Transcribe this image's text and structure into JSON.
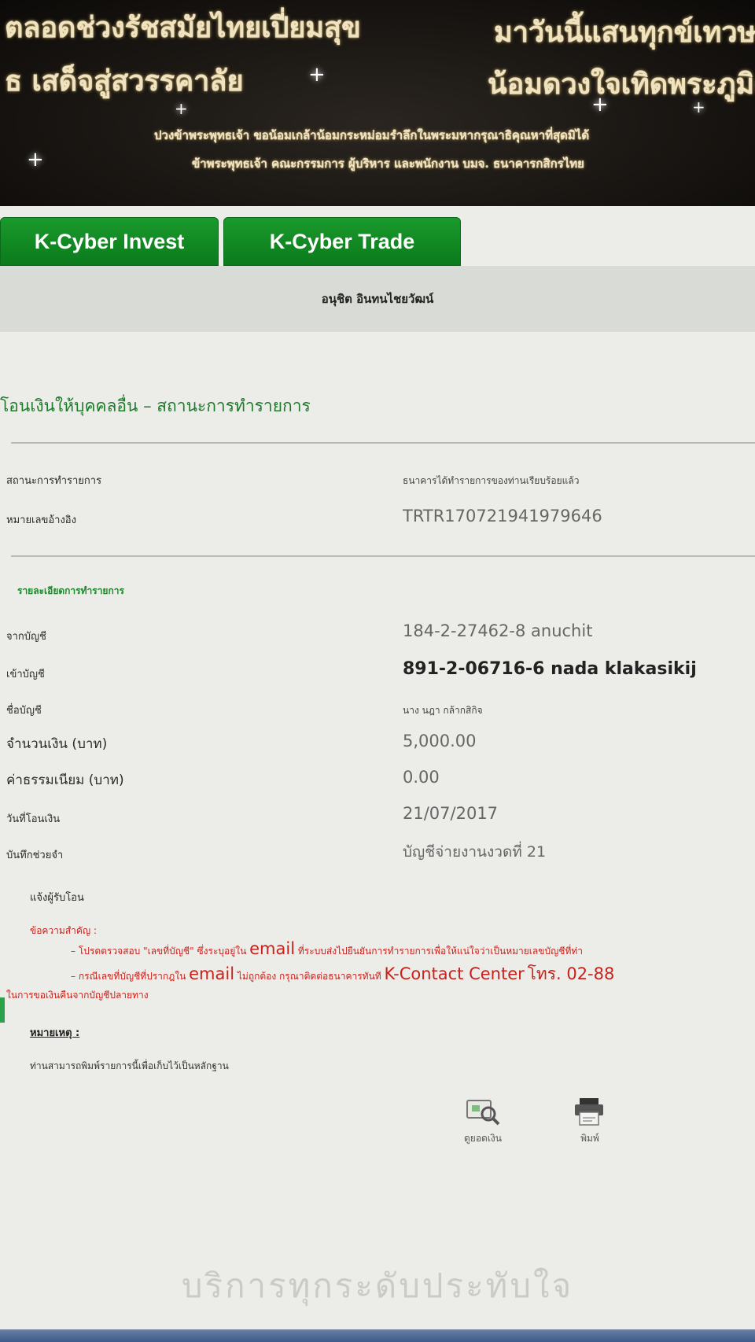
{
  "banner": {
    "line1": "ตลอดช่วงรัชสมัยไทยเปี่ยมสุข",
    "line2": "ธ เสด็จสู่สวรรคาลัย",
    "line3": "มาวันนี้แสนทุกข์เทวษ",
    "line4": "น้อมดวงใจเทิดพระภูมิต",
    "dedication1": "ปวงข้าพระพุทธเจ้า ขอน้อมเกล้าน้อมกระหม่อมรำลึกในพระมหากรุณาธิคุณหาที่สุดมิได้",
    "dedication2": "ข้าพระพุทธเจ้า คณะกรรมการ ผู้บริหาร และพนักงาน บมจ. ธนาคารกสิกรไทย"
  },
  "tabs": [
    {
      "label": "K-Cyber Invest"
    },
    {
      "label": "K-Cyber Trade"
    }
  ],
  "user": {
    "name": "อนุชิต อินทนไชยวัฒน์"
  },
  "page": {
    "heading": "โอนเงินให้บุคคลอื่น – สถานะการทำรายการ"
  },
  "status": {
    "label": "สถานะการทำรายการ",
    "value": "ธนาคารได้ทำรายการของท่านเรียบร้อยแล้ว"
  },
  "reference": {
    "label": "หมายเลขอ้างอิง",
    "value": "TRTR170721941979646"
  },
  "details_title": "รายละเอียดการทำรายการ",
  "details": [
    {
      "label": "จากบัญชี",
      "value": "184-2-27462-8 anuchit"
    },
    {
      "label": "เข้าบัญชี",
      "value": "891-2-06716-6 nada klakasikij"
    },
    {
      "label": "ชื่อบัญชี",
      "value": "นาง นฎา กล้ากสิกิจ"
    },
    {
      "label": "จำนวนเงิน (บาท)",
      "value": "5,000.00"
    },
    {
      "label": "ค่าธรรมเนียม (บาท)",
      "value": "0.00"
    },
    {
      "label": "วันที่โอนเงิน",
      "value": "21/07/2017"
    },
    {
      "label": "บันทึกช่วยจำ",
      "value": "บัญชีจ่ายงานงวดที่ 21"
    },
    {
      "label": "แจ้งผู้รับโอน",
      "value": ""
    }
  ],
  "notes": {
    "title": "ข้อความสำคัญ :",
    "line1_pre": "– โปรดตรวจสอบ \"เลขที่บัญชี\" ซึ่งระบุอยู่ใน",
    "line1_em": "email",
    "line1_post": "ที่ระบบส่งไปยืนยันการทำรายการเพื่อให้แน่ใจว่าเป็นหมายเลขบัญชีที่ท่า",
    "line2_pre": "– กรณีเลขที่บัญชีที่ปรากฎใน",
    "line2_em": "email",
    "line2_mid": "ไม่ถูกต้อง กรุณาติดต่อธนาคารทันที",
    "line2_em2": "K-Contact Center",
    "line2_post": "โทร. 02-88",
    "line3": "ในการขอเงินคืนจากบัญชีปลายทาง"
  },
  "remark": {
    "title": "หมายเหตุ :",
    "text": "ท่านสามารถพิมพ์รายการนี้เพื่อเก็บไว้เป็นหลักฐาน"
  },
  "tools": {
    "balance_label": "ดูยอดเงิน",
    "print_label": "พิมพ์"
  },
  "footer": {
    "slogan": "บริการทุกระดับประทับใจ"
  },
  "colors": {
    "k_green": "#0b7a1c",
    "heading_green": "#1c7a2a",
    "note_red": "#c8221c",
    "banner_gold": "#efe3c2"
  }
}
